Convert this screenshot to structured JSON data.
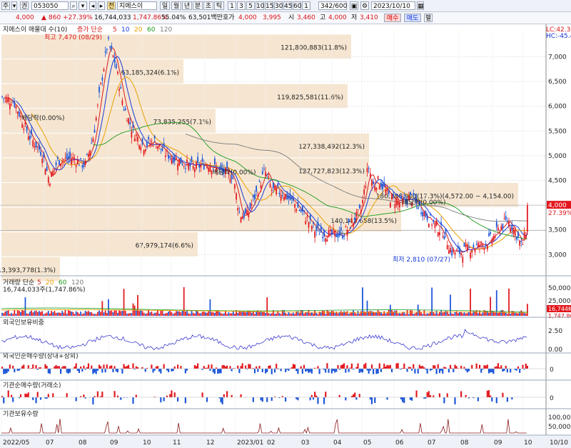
{
  "toolbar1": {
    "mode_main": "주",
    "mode_sub": "권",
    "code": "053050",
    "btn_jeon": "전",
    "name": "지에스이",
    "period_btns": [
      "주",
      "월",
      "년",
      "분",
      "초",
      "틱"
    ],
    "min_btns": [
      "1",
      "3",
      "5",
      "10",
      "15",
      "30",
      "45",
      "60",
      "1"
    ],
    "count": "342/600",
    "date": "2023/10/10"
  },
  "toolbar2": {
    "price": "4,000",
    "change": "860",
    "change_pct": "+27.39%",
    "volume": "16,744,033",
    "vol_pct": "1,747.86%",
    "turnover": "55.04%",
    "amount": "63,501백만",
    "hoga_label": "호가",
    "hoga1": "4,000",
    "hoga2": "3,995",
    "open_label": "시",
    "open": "3,460",
    "high_label": "고",
    "high": "4,000",
    "low_label": "저",
    "low": "3,410",
    "buy_label": "매수",
    "sell_label": "매도",
    "extra_label": "펼"
  },
  "main_panel": {
    "legend_title": "지에스이 매물대 수(10)",
    "legend_ma_label": "증가 단순",
    "legend_ma": [
      "5",
      "10",
      "20",
      "60",
      "120"
    ],
    "legend_ma_colors": [
      "#d81a1a",
      "#1a3ad8",
      "#e8a000",
      "#1a9a1a",
      "#7a7a7a"
    ],
    "max_label": "최고 7,470 (08/29)",
    "min_label": "최저 2,810 (07/27)",
    "lc_label": "LC:42.35",
    "hc_label": "HC:-45.40",
    "y_ticks": [
      "7,000",
      "6,500",
      "6,000",
      "5,500",
      "5,000",
      "4,500",
      "3,500",
      "3,000"
    ],
    "current_price_tag": "4,000",
    "current_pct_tag": "27.39%",
    "volume_profile": [
      {
        "price_top": 7450,
        "price_bottom": 6950,
        "label": "121,800,883(11.8%)"
      },
      {
        "price_top": 6950,
        "price_bottom": 6450,
        "label": "63,185,324(6.1%)"
      },
      {
        "price_top": 6450,
        "price_bottom": 5950,
        "label": "119,825,581(11.6%)"
      },
      {
        "price_top": 5950,
        "price_bottom": 5450,
        "label": "73,835,255(7.1%)"
      },
      {
        "price_top": 5450,
        "price_bottom": 4950,
        "label": "127,338,492(12.3%)"
      },
      {
        "price_top": 4950,
        "price_bottom": 4450,
        "label": "127,727,823(12.3%)"
      },
      {
        "price_top": 4450,
        "price_bottom": 3950,
        "label": "180,386,900(17.3%)(4,572.00 ~ 4,154.00)"
      },
      {
        "price_top": 3950,
        "price_bottom": 3450,
        "label": "140,142,658(13.5%)"
      },
      {
        "price_top": 3450,
        "price_bottom": 2950,
        "label": "67,979,174(6.6%)"
      },
      {
        "price_top": 2950,
        "price_bottom": 2450,
        "label": "13,393,778(1.3%)"
      }
    ],
    "annotations": [
      "배당락(0.00%)",
      "배당락(0.00%)",
      "배당락(0.00%)"
    ]
  },
  "volume_panel": {
    "legend": "거래량 단순",
    "legend_ma": [
      "5",
      "20",
      "60",
      "120"
    ],
    "legend_ma_colors": [
      "#d81a1a",
      "#e8a000",
      "#1a9a1a",
      "#7a7a7a"
    ],
    "value": "16,744,033주(1,747.86%)",
    "y_ticks": [
      "50,000K",
      "25,000K"
    ],
    "last_tag": "16,744K",
    "last_pct": "1,747.86%"
  },
  "foreign_panel": {
    "legend": "외국인보유비중",
    "y_ticks": [
      "2.50",
      "0.00"
    ]
  },
  "foreign_net_panel": {
    "legend": "외국인순매수량(장내+장외)",
    "y_ticks": [
      "0"
    ]
  },
  "inst_net_panel": {
    "legend": "기관순매수량(거래소)",
    "y_ticks": [
      "0"
    ]
  },
  "inst_hold_panel": {
    "legend": "기관보유수량",
    "y_ticks": [
      "100,000",
      "50,000"
    ]
  },
  "x_axis": {
    "labels": [
      "2022/05",
      "07",
      "08",
      "09",
      "10",
      "11",
      "12",
      "2023/01",
      "02",
      "03",
      "04",
      "05",
      "06",
      "07",
      "08",
      "09",
      "10",
      "10/10"
    ]
  },
  "chart_data": {
    "type": "candlestick",
    "title": "",
    "ylim": [
      2600,
      7600
    ],
    "notable": {
      "high": 7470,
      "low": 2810,
      "last_close": 4000
    }
  }
}
